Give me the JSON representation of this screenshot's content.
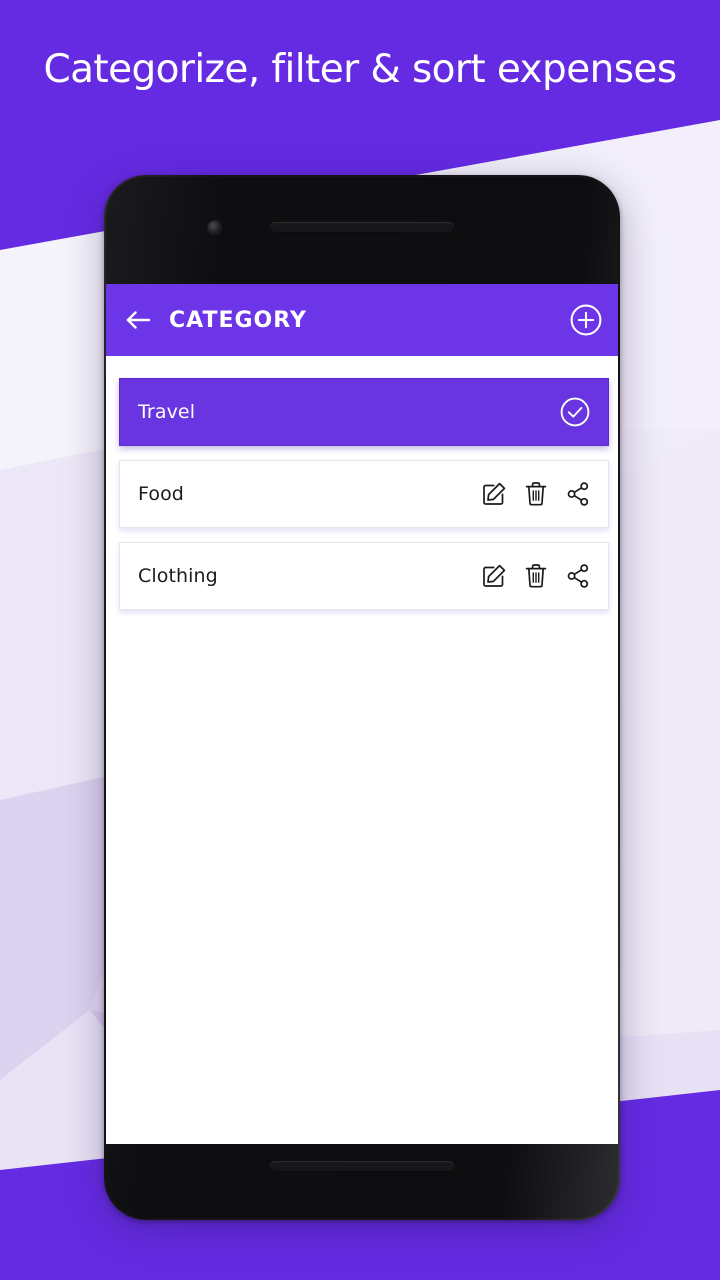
{
  "headline": "Categorize, filter & sort expenses",
  "colors": {
    "banner_purple": "#652be3",
    "appbar_purple": "#6c35e8",
    "selected_row_purple": "#6935e0",
    "background_lavender": "#ece9f7",
    "card_white": "#ffffff",
    "text_dark": "#1b1b1b"
  },
  "appbar": {
    "back_icon": "arrow-left-icon",
    "title": "CATEGORY",
    "add_icon": "plus-circle-icon"
  },
  "actions": {
    "edit_icon": "edit-pencil-icon",
    "delete_icon": "trash-icon",
    "share_icon": "share-icon",
    "selected_icon": "check-circle-icon"
  },
  "categories": [
    {
      "label": "Travel",
      "selected": true
    },
    {
      "label": "Food",
      "selected": false
    },
    {
      "label": "Clothing",
      "selected": false
    }
  ]
}
